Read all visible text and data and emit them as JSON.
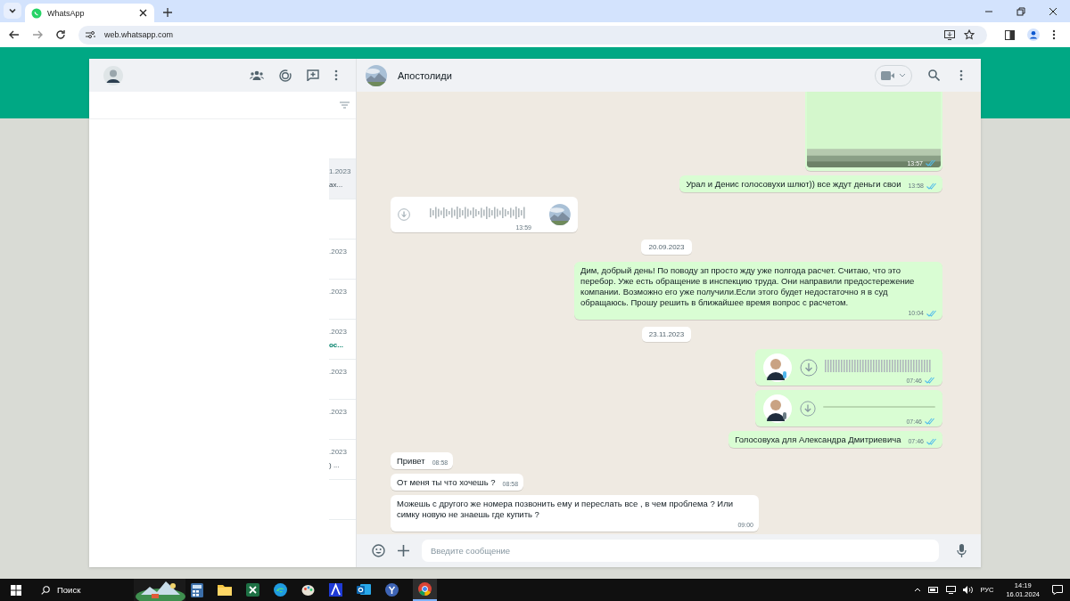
{
  "browser": {
    "tab_title": "WhatsApp",
    "url": "web.whatsapp.com"
  },
  "chat_list": {
    "rows": [
      {
        "selected": false
      },
      {
        "time": "1.2023",
        "preview": "ах...",
        "selected": true,
        "unread": false
      },
      {
        "selected": false
      },
      {
        "time": ".2023",
        "selected": false
      },
      {
        "time": ".2023",
        "selected": false
      },
      {
        "time": ".2023",
        "preview": "ос...",
        "selected": false,
        "unread": true
      },
      {
        "time": ".2023",
        "selected": false
      },
      {
        "time": ".2023",
        "selected": false
      },
      {
        "time": ".2023",
        "preview": ") ...",
        "selected": false,
        "unread": false
      },
      {
        "selected": false
      }
    ]
  },
  "chat": {
    "name": "Апостолиди",
    "messages": [
      {
        "outgoing": true,
        "time": "13:57",
        "read": true
      },
      {
        "kind": "text",
        "outgoing": true,
        "text": "Урал и Денис голосовухи шлют)) все ждут деньги свои",
        "time": "13:58",
        "read": true
      },
      {
        "kind": "voice",
        "outgoing": false,
        "time": "13:59",
        "waveform": true
      },
      {
        "kind": "date",
        "text": "20.09.2023"
      },
      {
        "kind": "text",
        "outgoing": true,
        "text": "Дим, добрый день! По поводу зп просто жду уже полгода расчет. Считаю, что это перебор. Уже есть обращение в инспекцию труда. Они направили предостережение компании. Возможно его уже получили.Если этого будет недостаточно я в суд обращаюсь. Прошу решить в ближайшее время вопрос с расчетом.",
        "time": "10:04",
        "read": true
      },
      {
        "kind": "date",
        "text": "23.11.2023"
      },
      {
        "kind": "voice",
        "outgoing": true,
        "time": "07:46",
        "read": true,
        "waveform": true
      },
      {
        "kind": "voice",
        "outgoing": true,
        "time": "07:46",
        "read": true,
        "waveform": false
      },
      {
        "kind": "text",
        "outgoing": true,
        "text": "Голосовуха для Александра Дмитриевича",
        "time": "07:46",
        "read": true
      },
      {
        "kind": "text",
        "outgoing": false,
        "text": "Привет",
        "time": "08:58"
      },
      {
        "kind": "text",
        "outgoing": false,
        "text": "От меня ты что хочешь ?",
        "time": "08:58"
      },
      {
        "kind": "text",
        "outgoing": false,
        "text": "Можешь с другого же номера позвонить ему и переслать все , в чем проблема ? Или симку новую не знаешь где купить ?",
        "time": "09:00"
      }
    ],
    "composer": {
      "placeholder": "Введите сообщение"
    }
  },
  "taskbar": {
    "search": "Поиск",
    "language": "РУС",
    "clock_time": "14:19",
    "clock_date": "16.01.2024"
  }
}
